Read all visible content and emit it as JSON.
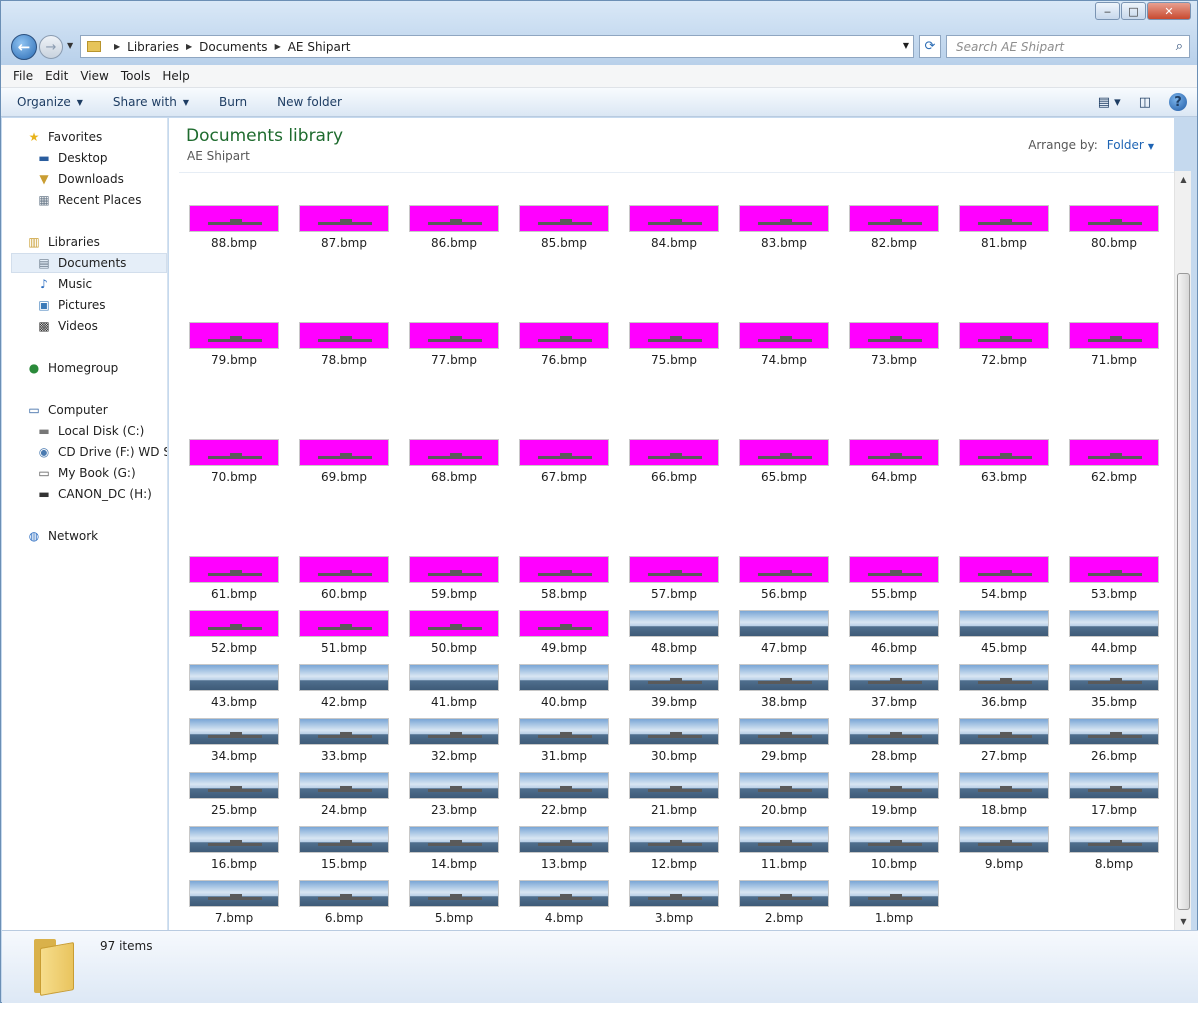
{
  "window": {
    "caption_minimize": "‒",
    "caption_maximize": "□",
    "caption_close": "✕"
  },
  "address": {
    "breadcrumb": [
      "Libraries",
      "Documents",
      "AE Shipart"
    ],
    "search_placeholder": "Search AE Shipart"
  },
  "menu": [
    "File",
    "Edit",
    "View",
    "Tools",
    "Help"
  ],
  "toolbar": {
    "organize": "Organize",
    "share_with": "Share with",
    "burn": "Burn",
    "new_folder": "New folder"
  },
  "sidebar": {
    "favorites": "Favorites",
    "desktop": "Desktop",
    "downloads": "Downloads",
    "recent_places": "Recent Places",
    "libraries": "Libraries",
    "documents": "Documents",
    "music": "Music",
    "pictures": "Pictures",
    "videos": "Videos",
    "homegroup": "Homegroup",
    "computer": "Computer",
    "local_disk": "Local Disk (C:)",
    "cd_drive": "CD Drive (F:) WD Sm",
    "my_book": "My Book (G:)",
    "canon": "CANON_DC (H:)",
    "network": "Network"
  },
  "library": {
    "title": "Documents library",
    "subtitle": "AE Shipart",
    "arrange_label": "Arrange by:",
    "arrange_value": "Folder"
  },
  "files": [
    "88.bmp",
    "87.bmp",
    "86.bmp",
    "85.bmp",
    "84.bmp",
    "83.bmp",
    "82.bmp",
    "81.bmp",
    "80.bmp",
    "79.bmp",
    "78.bmp",
    "77.bmp",
    "76.bmp",
    "75.bmp",
    "74.bmp",
    "73.bmp",
    "72.bmp",
    "71.bmp",
    "70.bmp",
    "69.bmp",
    "68.bmp",
    "67.bmp",
    "66.bmp",
    "65.bmp",
    "64.bmp",
    "63.bmp",
    "62.bmp",
    "61.bmp",
    "60.bmp",
    "59.bmp",
    "58.bmp",
    "57.bmp",
    "56.bmp",
    "55.bmp",
    "54.bmp",
    "53.bmp",
    "52.bmp",
    "51.bmp",
    "50.bmp",
    "49.bmp",
    "48.bmp",
    "47.bmp",
    "46.bmp",
    "45.bmp",
    "44.bmp",
    "43.bmp",
    "42.bmp",
    "41.bmp",
    "40.bmp",
    "39.bmp",
    "38.bmp",
    "37.bmp",
    "36.bmp",
    "35.bmp",
    "34.bmp",
    "33.bmp",
    "32.bmp",
    "31.bmp",
    "30.bmp",
    "29.bmp",
    "28.bmp",
    "27.bmp",
    "26.bmp",
    "25.bmp",
    "24.bmp",
    "23.bmp",
    "22.bmp",
    "21.bmp",
    "20.bmp",
    "19.bmp",
    "18.bmp",
    "17.bmp",
    "16.bmp",
    "15.bmp",
    "14.bmp",
    "13.bmp",
    "12.bmp",
    "11.bmp",
    "10.bmp",
    "9.bmp",
    "8.bmp",
    "7.bmp",
    "6.bmp",
    "5.bmp",
    "4.bmp",
    "3.bmp",
    "2.bmp",
    "1.bmp"
  ],
  "magenta_file_count": 40,
  "status": {
    "item_count": "97 items"
  },
  "colors": {
    "magenta_thumb": "#ff00ff",
    "library_title": "#1e6b2e",
    "link": "#1e64b4"
  }
}
